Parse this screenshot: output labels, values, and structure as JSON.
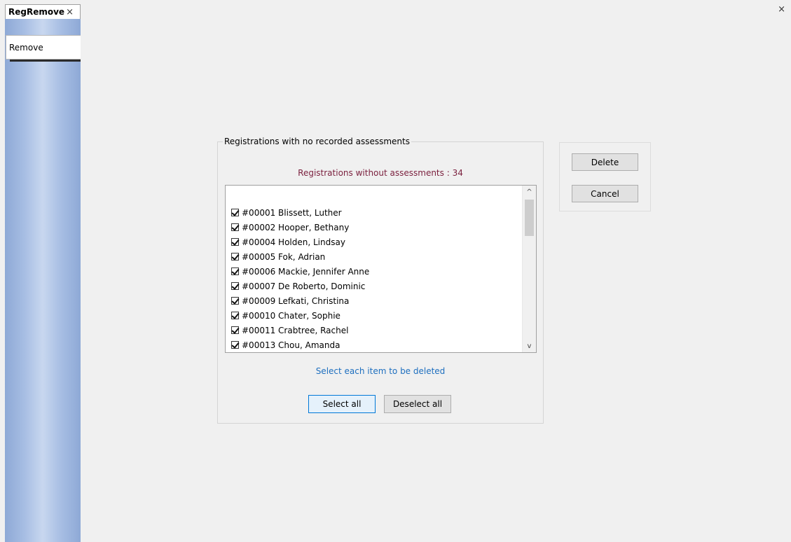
{
  "tabbar": {
    "tab_label": "RegRemove",
    "tab_close": "×",
    "window_close": "×"
  },
  "sidebar": {
    "tab_label": "Remove"
  },
  "group": {
    "legend": "Registrations with no recorded assessments",
    "count_label": "Registrations without assessments : 34",
    "hint": "Select each item to be deleted",
    "select_all_label": "Select all",
    "deselect_all_label": "Deselect all"
  },
  "list": {
    "items": [
      {
        "label": "#00001 Blissett, Luther",
        "checked": true
      },
      {
        "label": "#00002 Hooper, Bethany",
        "checked": true
      },
      {
        "label": "#00004 Holden, Lindsay",
        "checked": true
      },
      {
        "label": "#00005 Fok, Adrian",
        "checked": true
      },
      {
        "label": "#00006 Mackie, Jennifer Anne",
        "checked": true
      },
      {
        "label": "#00007 De Roberto, Dominic",
        "checked": true
      },
      {
        "label": "#00009 Lefkati, Christina",
        "checked": true
      },
      {
        "label": "#00010 Chater, Sophie",
        "checked": true
      },
      {
        "label": "#00011 Crabtree, Rachel",
        "checked": true
      },
      {
        "label": "#00013 Chou, Amanda",
        "checked": true
      }
    ],
    "scroll_up_glyph": "^",
    "scroll_down_glyph": "v"
  },
  "actions": {
    "delete_label": "Delete",
    "cancel_label": "Cancel"
  },
  "colors": {
    "count_label": "#7a1f3d",
    "hint": "#1e6fbf",
    "sidebar": "#a6bde3"
  }
}
